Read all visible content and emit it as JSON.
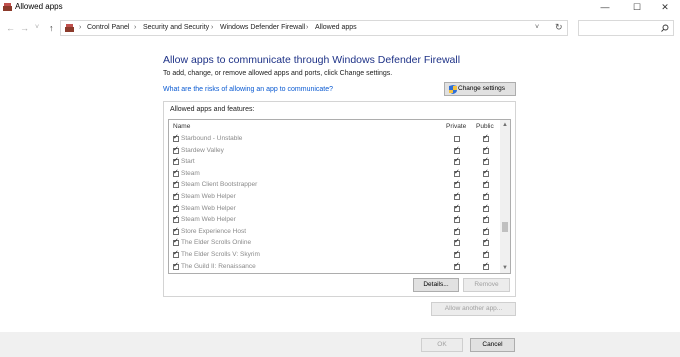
{
  "window": {
    "title": "Allowed apps",
    "minimize": "—",
    "maximize": "☐",
    "close": "✕"
  },
  "nav": {
    "back": "←",
    "forward": "→",
    "recent": "˅",
    "up": "↑",
    "dropdown": "˅",
    "refresh": "↻",
    "search_placeholder": ""
  },
  "breadcrumb": {
    "items": [
      "Control Panel",
      "Security and Security",
      "Windows Defender Firewall",
      "Allowed apps"
    ],
    "separator": "›"
  },
  "page": {
    "title": "Allow apps to communicate through Windows Defender Firewall",
    "subtitle": "To add, change, or remove allowed apps and ports, click Change settings.",
    "risk_link": "What are the risks of allowing an app to communicate?",
    "change_settings": "Change settings"
  },
  "apps": {
    "group_label": "Allowed apps and features:",
    "columns": {
      "name": "Name",
      "private": "Private",
      "public": "Public"
    },
    "rows": [
      {
        "name": "Starbound - Unstable",
        "enabled": true,
        "private": false,
        "public": true
      },
      {
        "name": "Stardew Valley",
        "enabled": true,
        "private": true,
        "public": true
      },
      {
        "name": "Start",
        "enabled": true,
        "private": true,
        "public": true
      },
      {
        "name": "Steam",
        "enabled": true,
        "private": true,
        "public": true
      },
      {
        "name": "Steam Client Bootstrapper",
        "enabled": true,
        "private": true,
        "public": true
      },
      {
        "name": "Steam Web Helper",
        "enabled": true,
        "private": true,
        "public": true
      },
      {
        "name": "Steam Web Helper",
        "enabled": true,
        "private": true,
        "public": true
      },
      {
        "name": "Steam Web Helper",
        "enabled": true,
        "private": true,
        "public": true
      },
      {
        "name": "Store Experience Host",
        "enabled": true,
        "private": true,
        "public": true
      },
      {
        "name": "The Elder Scrolls Online",
        "enabled": true,
        "private": true,
        "public": true
      },
      {
        "name": "The Elder Scrolls V: Skyrim",
        "enabled": true,
        "private": true,
        "public": true
      },
      {
        "name": "The Guild II: Renaissance",
        "enabled": true,
        "private": true,
        "public": true
      }
    ],
    "details": "Details...",
    "remove": "Remove",
    "allow_another": "Allow another app..."
  },
  "footer": {
    "ok": "OK",
    "cancel": "Cancel"
  },
  "colors": {
    "title": "#1e3287",
    "link": "#0a5ad2",
    "disabled_text": "#a0a0a0",
    "bar": "#f0f0f0"
  }
}
